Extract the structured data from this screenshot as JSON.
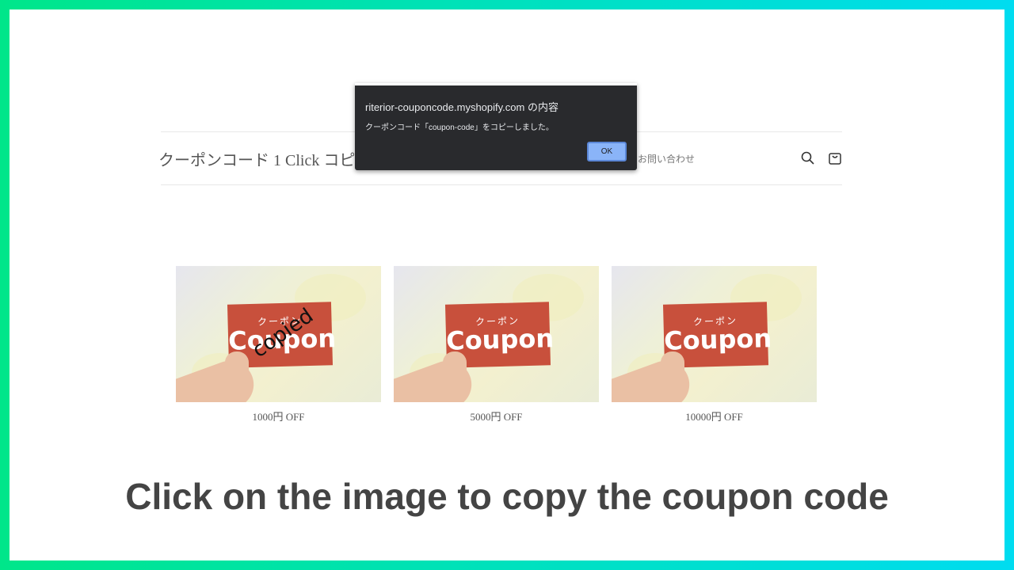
{
  "store": {
    "title": "クーポンコード 1 Click コピー",
    "nav_contact": "お問い合わせ"
  },
  "dialog": {
    "title": "riterior-couponcode.myshopify.com の内容",
    "message": "クーポンコード「coupon-code」をコピーしました。",
    "ok_label": "OK"
  },
  "products": [
    {
      "caption": "1000円 OFF",
      "card_jp": "クーポン",
      "card_en": "Coupon",
      "overlay": "copied"
    },
    {
      "caption": "5000円 OFF",
      "card_jp": "クーポン",
      "card_en": "Coupon"
    },
    {
      "caption": "10000円 OFF",
      "card_jp": "クーポン",
      "card_en": "Coupon"
    }
  ],
  "headline": "Click on the image to copy the coupon code",
  "colors": {
    "border_left": "#00e68a",
    "border_right": "#00dcf0",
    "dialog_bg": "#292a2d",
    "ok_button": "#8ab4f8",
    "coupon_red": "#c8503c"
  }
}
